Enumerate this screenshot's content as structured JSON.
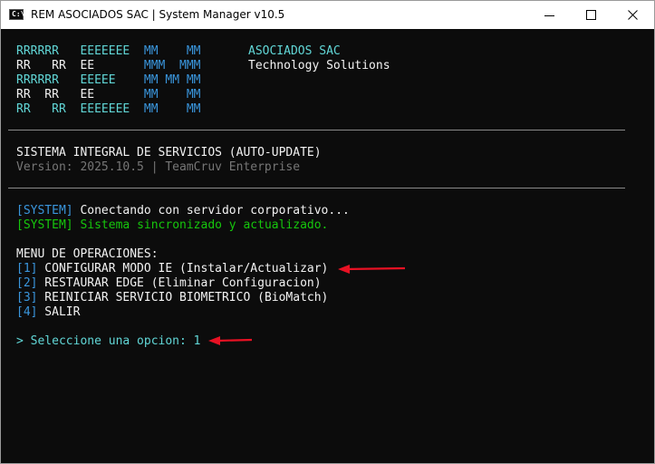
{
  "window": {
    "title": "REM ASOCIADOS SAC | System Manager v10.5",
    "icon": "console-icon",
    "icon_glyph": "C:\\"
  },
  "banner": {
    "art": [
      "RRRRRR   EEEEEEE  MM    MM",
      "RR   RR  EE       MMM  MMM",
      "RRRRRR   EEEEE    MM MM MM",
      "RR  RR   EE       MM    MM",
      "RR   RR  EEEEEEE  MM    MM"
    ],
    "company": "ASOCIADOS SAC",
    "tagline": "Technology Solutions"
  },
  "system": {
    "name": "SISTEMA INTEGRAL DE SERVICIOS (AUTO-UPDATE)",
    "version": "Version: 2025.10.5 | TeamCruv Enterprise"
  },
  "log": [
    {
      "tag": "[SYSTEM]",
      "text": " Conectando con servidor corporativo..."
    },
    {
      "tag": "[SYSTEM]",
      "text": " Sistema sincronizado y actualizado."
    }
  ],
  "menu": {
    "heading": "MENU DE OPERACIONES:",
    "items": [
      {
        "key": "[1]",
        "label": " CONFIGURAR MODO IE (Instalar/Actualizar)"
      },
      {
        "key": "[2]",
        "label": " RESTAURAR EDGE (Eliminar Configuracion)"
      },
      {
        "key": "[3]",
        "label": " REINICIAR SERVICIO BIOMETRICO (BioMatch)"
      },
      {
        "key": "[4]",
        "label": " SALIR"
      }
    ]
  },
  "prompt": {
    "text": "> Seleccione una opcion: ",
    "value": "1"
  },
  "colors": {
    "background": "#0c0c0c",
    "foreground": "#cccccc",
    "accent_blue": "#3a96dd",
    "accent_cyan": "#61d6d6",
    "success_green": "#16c60c",
    "annotation_red": "#e81123"
  }
}
